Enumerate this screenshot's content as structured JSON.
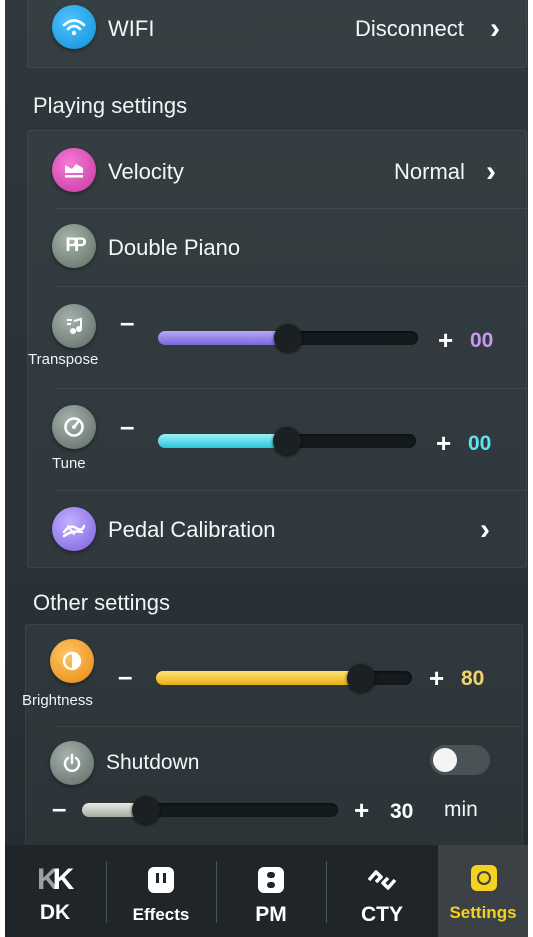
{
  "wifi": {
    "label": "WIFI",
    "value": "Disconnect",
    "chevron": "›"
  },
  "playing_settings": {
    "title": "Playing settings",
    "velocity": {
      "label": "Velocity",
      "value": "Normal",
      "chevron": "›"
    },
    "double_piano": {
      "label": "Double Piano"
    },
    "transpose": {
      "label": "Transpose",
      "minus": "–",
      "plus": "+",
      "value": "00",
      "fraction": 0.5
    },
    "tune": {
      "label": "Tune",
      "minus": "–",
      "plus": "+",
      "value": "00",
      "fraction": 0.5
    },
    "pedal_calibration": {
      "label": "Pedal Calibration",
      "chevron": "›"
    }
  },
  "other_settings": {
    "title": "Other settings",
    "brightness": {
      "label": "Brightness",
      "minus": "–",
      "plus": "+",
      "value": "80",
      "fraction": 0.8
    },
    "shutdown": {
      "label": "Shutdown",
      "toggle_on": false,
      "minus": "–",
      "plus": "+",
      "value": "30",
      "unit": "min",
      "fraction": 0.25
    }
  },
  "nav": {
    "items": [
      {
        "label": "DK",
        "icon": "dk-logo-icon",
        "active": false
      },
      {
        "label": "Effects",
        "icon": "effects-icon",
        "active": false
      },
      {
        "label": "PM",
        "icon": "pm-icon",
        "active": false
      },
      {
        "label": "CTY",
        "icon": "cty-icon",
        "active": false
      },
      {
        "label": "Settings",
        "icon": "settings-icon",
        "active": true
      }
    ]
  },
  "colors": {
    "wifi_icon": "#1aa3e8",
    "velocity_icon": "#e04ab8",
    "transpose_fill": "#8f7ee8",
    "transpose_value": "#c59af0",
    "tune_fill": "#3fd9ea",
    "tune_value": "#5ee3ef",
    "brightness_fill": "#f2c12e",
    "brightness_value": "#f3d36a",
    "pedal_icon": "#9b7ff0",
    "settings_active": "#f5d21f"
  }
}
